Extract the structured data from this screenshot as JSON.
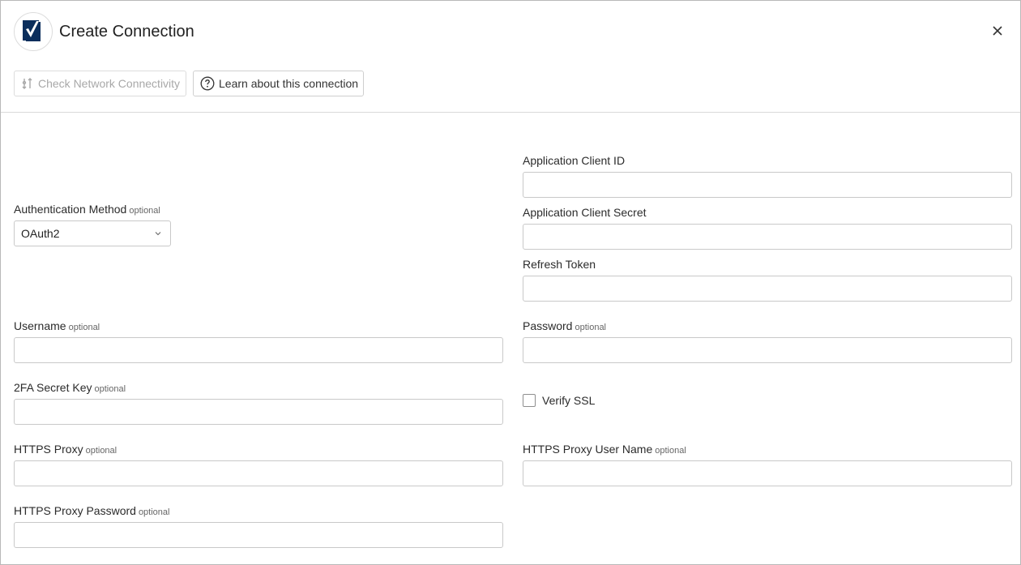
{
  "dialog": {
    "title": "Create Connection",
    "logo_icon": "smartsheet-logo-icon",
    "close_icon": "close-icon"
  },
  "toolbar": {
    "check_network_label": "Check Network Connectivity",
    "check_network_disabled": true,
    "learn_label": "Learn about this connection"
  },
  "optional_text": "optional",
  "form": {
    "auth_method": {
      "label": "Authentication Method",
      "value": "OAuth2"
    },
    "client_id": {
      "label": "Application Client ID",
      "value": ""
    },
    "client_secret": {
      "label": "Application Client Secret",
      "value": ""
    },
    "refresh_token": {
      "label": "Refresh Token",
      "value": ""
    },
    "username": {
      "label": "Username",
      "value": ""
    },
    "password": {
      "label": "Password",
      "value": ""
    },
    "twofa_key": {
      "label": "2FA Secret Key",
      "value": ""
    },
    "verify_ssl": {
      "label": "Verify SSL",
      "checked": false
    },
    "https_proxy": {
      "label": "HTTPS Proxy",
      "value": ""
    },
    "https_proxy_user": {
      "label": "HTTPS Proxy User Name",
      "value": ""
    },
    "https_proxy_password": {
      "label": "HTTPS Proxy Password",
      "value": ""
    }
  },
  "colors": {
    "brand": "#0b2e5c",
    "border": "#c9c9c9",
    "disabled_text": "#a8a8a8"
  }
}
